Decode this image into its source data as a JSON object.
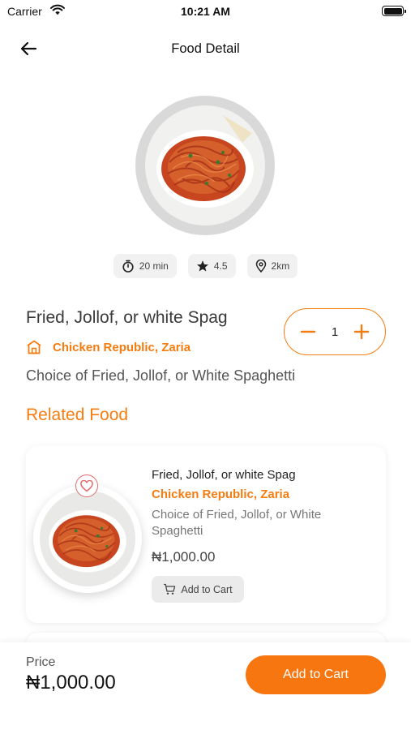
{
  "status_bar": {
    "carrier": "Carrier",
    "time": "10:21 AM",
    "wifi_icon": "wifi-icon",
    "battery_icon": "battery-icon"
  },
  "header": {
    "title": "Food Detail",
    "back_icon": "arrow-left-icon"
  },
  "food": {
    "image_icon": "spaghetti-plate-image",
    "chips": [
      {
        "icon": "stopwatch-icon",
        "label": "20 min"
      },
      {
        "icon": "star-icon",
        "label": "4.5"
      },
      {
        "icon": "location-pin-icon",
        "label": "2km"
      }
    ],
    "name": "Fried, Jollof, or white Spag",
    "restaurant": "Chicken Republic, Zaria",
    "restaurant_icon": "store-icon",
    "description": "Choice of Fried, Jollof, or White Spaghetti",
    "quantity": "1",
    "decrement_icon": "minus-icon",
    "increment_icon": "plus-icon"
  },
  "related": {
    "title": "Related Food",
    "items": [
      {
        "name": "Fried, Jollof, or white Spag",
        "restaurant": "Chicken Republic, Zaria",
        "description": "Choice of Fried, Jollof, or White Spaghetti",
        "price": "₦1,000.00",
        "cart_label": "Add to Cart",
        "favorite_icon": "heart-icon",
        "cart_icon": "cart-icon"
      }
    ]
  },
  "bottom_bar": {
    "price_label": "Price",
    "price_value": "₦1,000.00",
    "add_to_cart_label": "Add to Cart"
  },
  "colors": {
    "accent": "#f57c10",
    "button": "#f87610",
    "chip_bg": "#f1f1f1"
  }
}
